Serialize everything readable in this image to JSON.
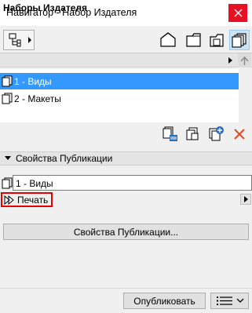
{
  "window": {
    "title": "Навигатор - Набор Издателя"
  },
  "sets_section": {
    "title": "Наборы Издателя"
  },
  "tree": {
    "items": [
      {
        "label": "1 - Виды",
        "selected": true
      },
      {
        "label": "2 - Макеты",
        "selected": false
      }
    ]
  },
  "properties_section": {
    "title": "Свойства Публикации"
  },
  "publication": {
    "name_value": "1 - Виды",
    "format_label": "Печать",
    "properties_button": "Свойства Публикации..."
  },
  "footer": {
    "publish_button": "Опубликовать"
  },
  "colors": {
    "selection": "#3399ff",
    "close_button": "#e81123",
    "highlight_outline": "#e60000",
    "delete_icon": "#e2491e"
  },
  "icons": [
    "close-icon",
    "navigator-dropdown-icon",
    "project-map-icon",
    "view-map-icon",
    "layout-book-icon",
    "publisher-sets-icon",
    "scroll-up-icon",
    "folder-view-icon",
    "new-publisher-set-icon",
    "new-folder-icon",
    "add-item-icon",
    "delete-icon",
    "collapse-triangle-icon",
    "publication-set-icon",
    "print-format-icon",
    "menu-icon"
  ]
}
